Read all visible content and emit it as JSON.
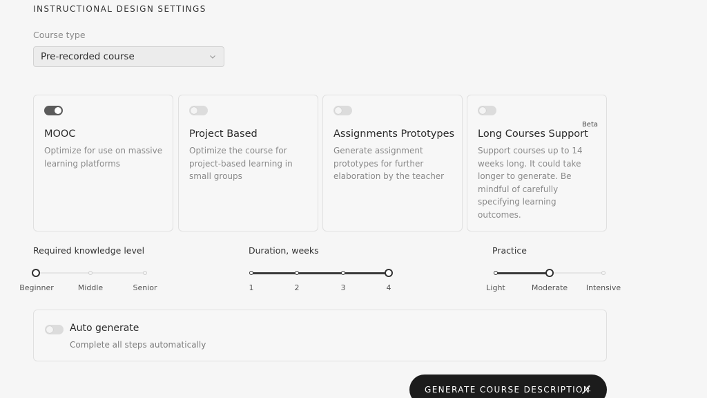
{
  "section_title": "INSTRUCTIONAL DESIGN SETTINGS",
  "course_type": {
    "label": "Course type",
    "value": "Pre-recorded course",
    "icon": "chevron-down-icon"
  },
  "cards": [
    {
      "title": "MOOC",
      "description": "Optimize for use on massive learning platforms",
      "enabled": true
    },
    {
      "title": "Project Based",
      "description": "Optimize the course for project-based learning in small groups",
      "enabled": false
    },
    {
      "title": "Assignments Prototypes",
      "description": "Generate assignment prototypes for further elaboration by the teacher",
      "enabled": false
    },
    {
      "title": "Long Courses Support",
      "badge": "Beta",
      "description": "Support courses up to 14 weeks long. It could take longer to generate. Be mindful of carefully specifying learning outcomes.",
      "enabled": false
    }
  ],
  "sliders": {
    "knowledge": {
      "label": "Required knowledge level",
      "options": [
        "Beginner",
        "Middle",
        "Senior"
      ],
      "selected": "Beginner"
    },
    "duration": {
      "label": "Duration, weeks",
      "options": [
        "1",
        "2",
        "3",
        "4"
      ],
      "selected": "4"
    },
    "practice": {
      "label": "Practice",
      "options": [
        "Light",
        "Moderate",
        "Intensive"
      ],
      "selected": "Moderate"
    }
  },
  "auto_generate": {
    "title": "Auto generate",
    "description": "Complete all steps automatically",
    "enabled": false
  },
  "generate_button": {
    "label": "GENERATE COURSE DESCRIPTION",
    "icon": "magic-wand-icon"
  },
  "colors": {
    "background": "#f6f6f6",
    "accent_dark": "#1c1c1c",
    "toggle_on": "#5b5b5b",
    "toggle_off": "#dcdcdc"
  }
}
